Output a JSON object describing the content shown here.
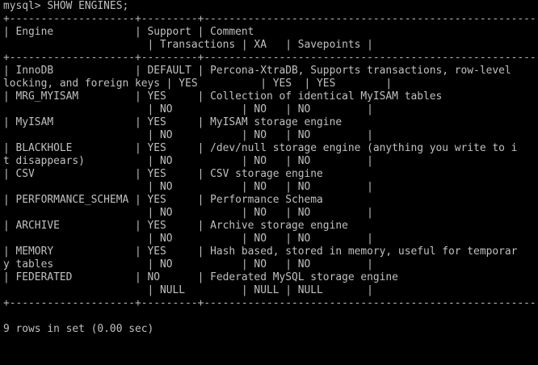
{
  "terminal": {
    "lines": [
      "mysql> SHOW ENGINES;",
      "+--------------------+---------+----------------------------------------------------------------------------+--------------+------+------------+",
      "| Engine             | Support | Comment",
      "                       | Transactions | XA   | Savepoints |",
      "+--------------------+---------+----------------------------------------------------------------------------+--------------+------+------------+",
      "| InnoDB             | DEFAULT | Percona-XtraDB, Supports transactions, row-level",
      "locking, and foreign keys | YES          | YES  | YES        |",
      "| MRG_MYISAM         | YES     | Collection of identical MyISAM tables",
      "                       | NO           | NO   | NO         |",
      "| MyISAM             | YES     | MyISAM storage engine",
      "                       | NO           | NO   | NO         |",
      "| BLACKHOLE          | YES     | /dev/null storage engine (anything you write to i",
      "t disappears)          | NO           | NO   | NO         |",
      "| CSV                | YES     | CSV storage engine",
      "                       | NO           | NO   | NO         |",
      "| PERFORMANCE_SCHEMA | YES     | Performance Schema",
      "                       | NO           | NO   | NO         |",
      "| ARCHIVE            | YES     | Archive storage engine",
      "                       | NO           | NO   | NO         |",
      "| MEMORY             | YES     | Hash based, stored in memory, useful for temporar",
      "y tables               | NO           | NO   | NO         |",
      "| FEDERATED          | NO      | Federated MySQL storage engine",
      "                       | NULL         | NULL | NULL       |",
      "+--------------------+---------+----------------------------------------------------------------------------+--------------+------+------------+",
      "",
      "9 rows in set (0.00 sec)"
    ]
  }
}
